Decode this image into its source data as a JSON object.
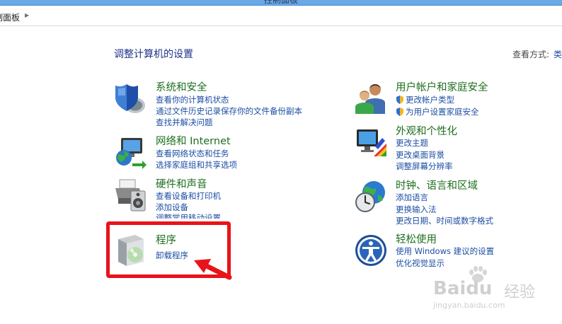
{
  "window": {
    "title": "控制面板"
  },
  "address": {
    "crumb": "制面板"
  },
  "heading": "调整计算机的设置",
  "view_by": {
    "label": "查看方式:",
    "value": "类"
  },
  "categories": {
    "system": {
      "title": "系统和安全",
      "links": [
        "查看你的计算机状态",
        "通过文件历史记录保存你的文件备份副本",
        "查找并解决问题"
      ]
    },
    "network": {
      "title": "网络和 Internet",
      "links": [
        "查看网络状态和任务",
        "选择家庭组和共享选项"
      ]
    },
    "hardware": {
      "title": "硬件和声音",
      "links": [
        "查看设备和打印机",
        "添加设备",
        "调整常用移动设置"
      ]
    },
    "programs": {
      "title": "程序",
      "links": [
        "卸载程序"
      ]
    },
    "users": {
      "title": "用户帐户和家庭安全",
      "links": [
        "更改帐户类型",
        "为用户设置家庭安全"
      ]
    },
    "appearance": {
      "title": "外观和个性化",
      "links": [
        "更改主题",
        "更改桌面背景",
        "调整屏幕分辨率"
      ]
    },
    "clock": {
      "title": "时钟、语言和区域",
      "links": [
        "添加语言",
        "更换输入法",
        "更改日期、时间或数字格式"
      ]
    },
    "ease": {
      "title": "轻松使用",
      "links": [
        "使用 Windows 建议的设置",
        "优化视觉显示"
      ]
    }
  },
  "annotation": {
    "color": "#e8141a"
  },
  "watermark": {
    "brand": "Baidu",
    "brand_cn": "经验",
    "url": "jingyan.baidu.com"
  },
  "colors": {
    "category_title": "#1e6e1e",
    "link": "#1c4ea3",
    "heading": "#1e3287"
  }
}
